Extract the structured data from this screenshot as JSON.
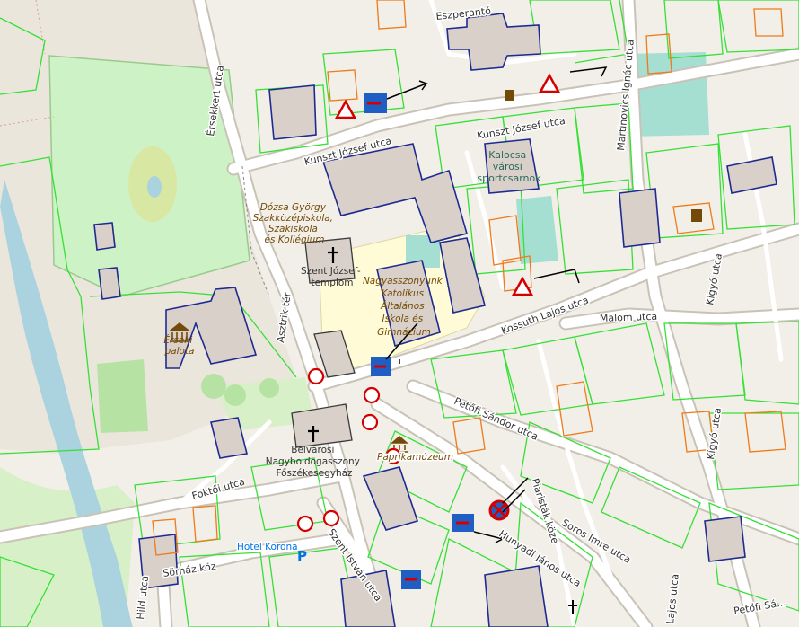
{
  "streets": {
    "ersekkert": "Érsekkert utca",
    "kunszt_1": "Kunszt József utca",
    "kunszt_2": "Kunszt József utca",
    "martinovics": "Martinovics Ignác utca",
    "kossuth": "Kossuth Lajos utca",
    "malom": "Malom utca",
    "kigyo_1": "Kígyó utca",
    "kigyo_2": "Kígyó utca",
    "petofi": "Petőfi Sándor utca",
    "petofi_2": "Petőfi Sá...",
    "astrik": "Asztrik tér",
    "foktoi": "Foktői utca",
    "szent_istvan": "Szent István utca",
    "sorhaz": "Sörház köz",
    "hild": "Hild utca",
    "hunyadi": "Hunyadi János utca",
    "soros_imre": "Soros Imre utca",
    "lajos": "Lajos utca",
    "piaristak": "Piaristák köze",
    "eszperanto": "Eszperantó"
  },
  "pois": {
    "dozsa": [
      "Dózsa György",
      "Szakközépiskola,",
      "Szakiskola",
      "és Kollégium"
    ],
    "szent_jozsef": [
      "Szent József-",
      "templom"
    ],
    "nagyasszonyunk": [
      "Nagyasszonyunk",
      "Katolikus",
      "Általános",
      "Iskola és",
      "Gimnázium"
    ],
    "kalocsa": [
      "Kalocsa",
      "városi",
      "sportcsarnok"
    ],
    "erseki": [
      "Érseki",
      "palota"
    ],
    "belvarosi": [
      "Belvárosi",
      "Nagyboldogasszony",
      "Főszékesegyház"
    ],
    "paprika": "Paprikamúzeum",
    "hotel": "Hotel Korona"
  },
  "icons": [
    "church-icon",
    "museum-icon",
    "parking-icon",
    "police-icon",
    "no-entry-icon",
    "give-way-icon",
    "one-way-icon",
    "no-stopping-icon",
    "library-icon"
  ],
  "colors": {
    "background": "#f2efe9",
    "road": "#ffffff",
    "plot_outline": "#35e035",
    "building": "#d9d0c9",
    "building_outline_blue": "#1f2a90",
    "building_outline_orange": "#ef7a1a",
    "park": "#c9efc0",
    "school": "#fffbd6",
    "river": "#aad3df",
    "pitch": "#a5dfd2"
  }
}
